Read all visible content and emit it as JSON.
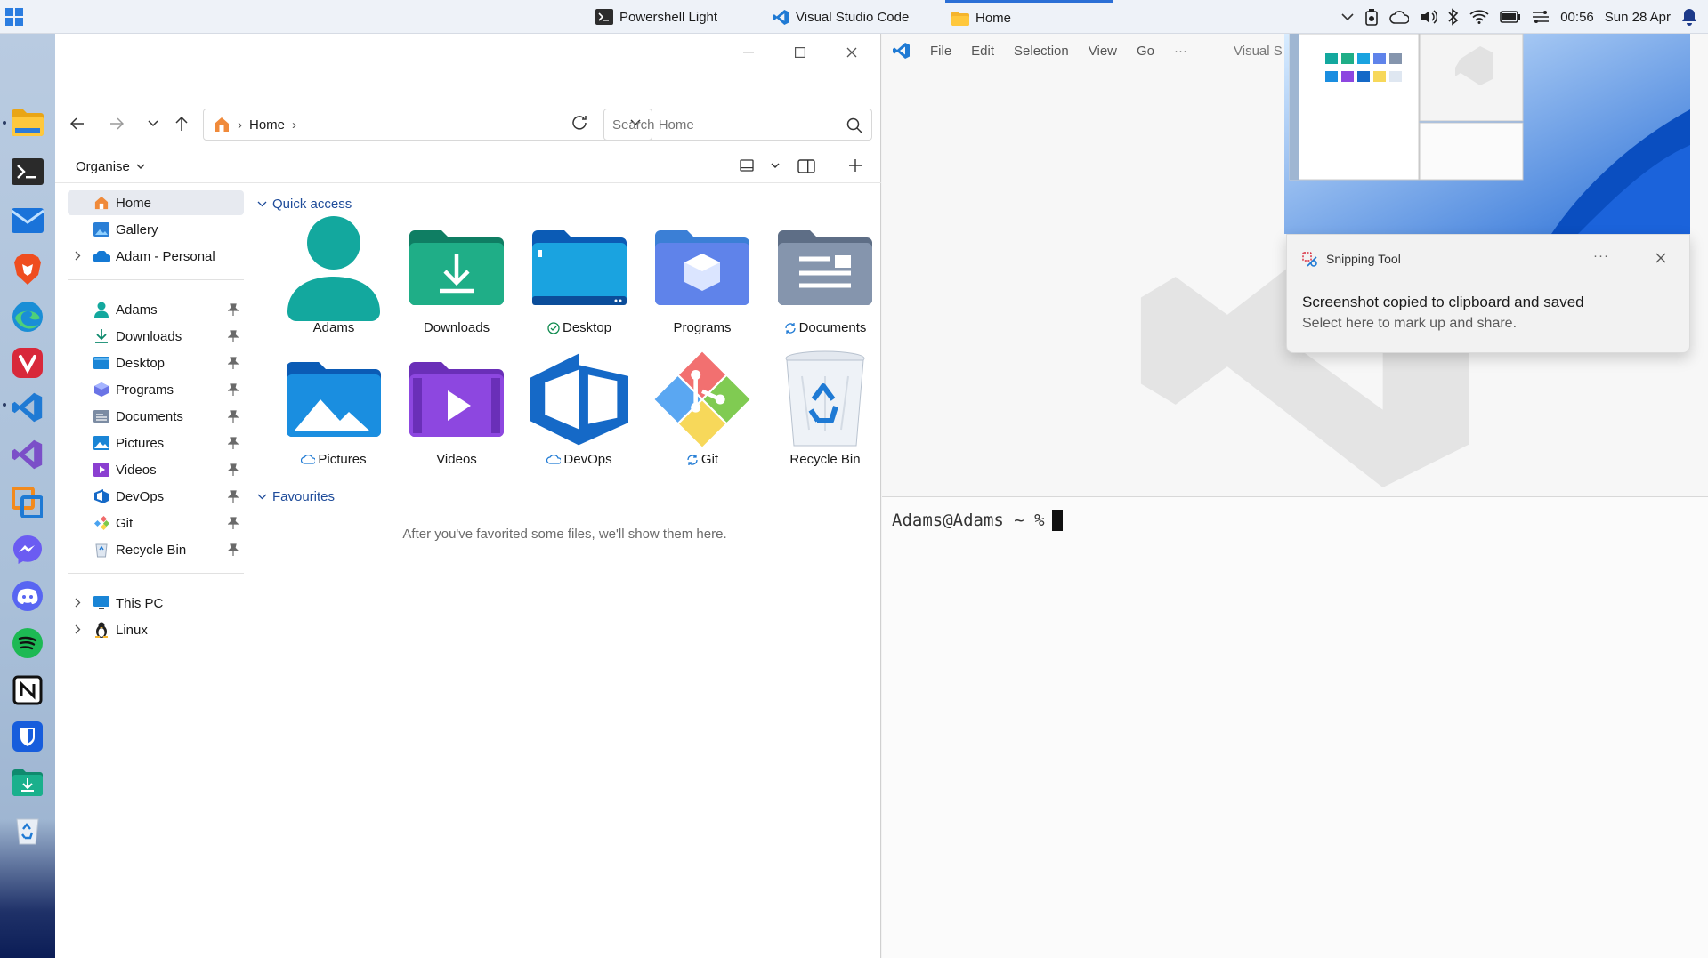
{
  "taskbar": {
    "tabs": [
      {
        "label": "Powershell Light",
        "icon": "terminal-icon"
      },
      {
        "label": "Visual Studio Code",
        "icon": "vscode-icon"
      },
      {
        "label": "Home",
        "icon": "folder-icon"
      }
    ],
    "tray": {
      "time": "00:56",
      "date": "Sun 28 Apr"
    }
  },
  "dock": {
    "apps": [
      "file-explorer-icon",
      "terminal-icon",
      "mail-icon",
      "brave-icon",
      "edge-icon",
      "vivaldi-icon",
      "vscode-icon",
      "visual-studio-icon",
      "vmware-icon",
      "messenger-icon",
      "discord-icon",
      "spotify-icon",
      "notion-icon",
      "bitwarden-icon",
      "downloads-icon",
      "recycle-bin-icon"
    ]
  },
  "explorer": {
    "address": {
      "location": "Home"
    },
    "search": {
      "placeholder": "Search Home"
    },
    "command_bar": {
      "organise": "Organise"
    },
    "nav": {
      "top": [
        {
          "label": "Home",
          "icon": "home-icon"
        },
        {
          "label": "Gallery",
          "icon": "gallery-icon"
        },
        {
          "label": "Adam - Personal",
          "icon": "onedrive-icon"
        }
      ],
      "pinned": [
        {
          "label": "Adams",
          "icon": "user-icon"
        },
        {
          "label": "Downloads",
          "icon": "download-icon"
        },
        {
          "label": "Desktop",
          "icon": "desktop-icon"
        },
        {
          "label": "Programs",
          "icon": "programs-icon"
        },
        {
          "label": "Documents",
          "icon": "documents-icon"
        },
        {
          "label": "Pictures",
          "icon": "pictures-icon"
        },
        {
          "label": "Videos",
          "icon": "videos-icon"
        },
        {
          "label": "DevOps",
          "icon": "devops-icon"
        },
        {
          "label": "Git",
          "icon": "git-icon"
        },
        {
          "label": "Recycle Bin",
          "icon": "recycle-bin-icon"
        }
      ],
      "bottom": [
        {
          "label": "This PC",
          "icon": "pc-icon"
        },
        {
          "label": "Linux",
          "icon": "linux-icon"
        }
      ]
    },
    "quick_access": {
      "title": "Quick access",
      "tiles": [
        {
          "label": "Adams",
          "status": ""
        },
        {
          "label": "Downloads",
          "status": ""
        },
        {
          "label": "Desktop",
          "status": "synced"
        },
        {
          "label": "Programs",
          "status": ""
        },
        {
          "label": "Documents",
          "status": "syncing"
        },
        {
          "label": "Pictures",
          "status": "cloud"
        },
        {
          "label": "Videos",
          "status": ""
        },
        {
          "label": "DevOps",
          "status": "cloud"
        },
        {
          "label": "Git",
          "status": "syncing"
        },
        {
          "label": "Recycle Bin",
          "status": ""
        }
      ]
    },
    "favourites": {
      "title": "Favourites",
      "empty_message": "After you've favorited some files, we'll show them here."
    }
  },
  "vscode": {
    "menu": [
      "File",
      "Edit",
      "Selection",
      "View",
      "Go",
      "···"
    ],
    "title_fragment": "Visual S"
  },
  "terminal": {
    "prompt": "Adams@Adams ~ %"
  },
  "notification": {
    "app": "Snipping Tool",
    "more": "···",
    "title": "Screenshot copied to clipboard and saved",
    "body": "Select here to mark up and share."
  }
}
